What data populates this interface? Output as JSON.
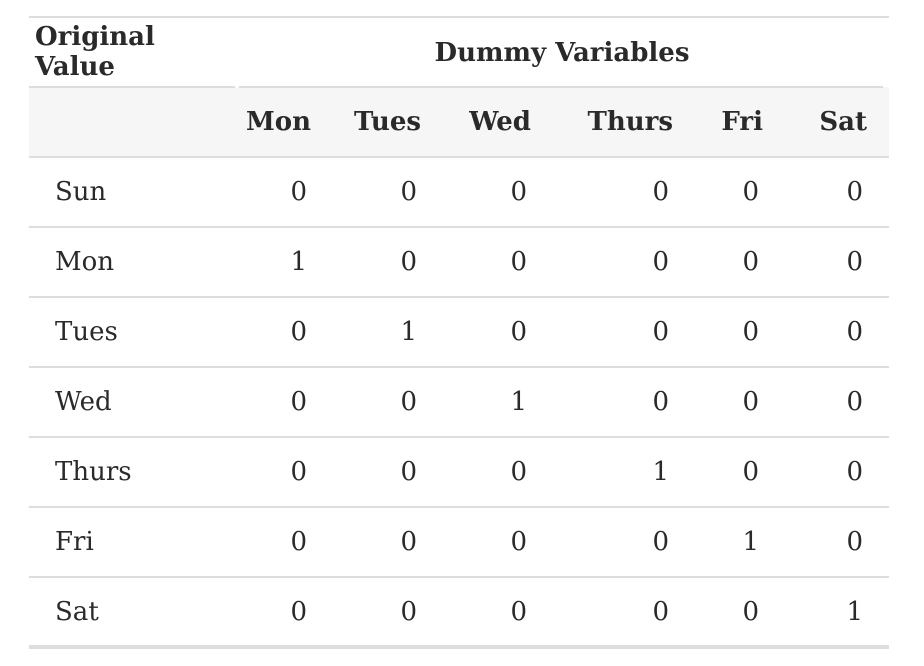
{
  "table": {
    "spanner": {
      "original_value": "Original Value",
      "dummy_variables": "Dummy Variables"
    },
    "columns": [
      "Mon",
      "Tues",
      "Wed",
      "Thurs",
      "Fri",
      "Sat"
    ],
    "rows": [
      {
        "label": "Sun",
        "values": [
          "0",
          "0",
          "0",
          "0",
          "0",
          "0"
        ]
      },
      {
        "label": "Mon",
        "values": [
          "1",
          "0",
          "0",
          "0",
          "0",
          "0"
        ]
      },
      {
        "label": "Tues",
        "values": [
          "0",
          "1",
          "0",
          "0",
          "0",
          "0"
        ]
      },
      {
        "label": "Wed",
        "values": [
          "0",
          "0",
          "1",
          "0",
          "0",
          "0"
        ]
      },
      {
        "label": "Thurs",
        "values": [
          "0",
          "0",
          "0",
          "1",
          "0",
          "0"
        ]
      },
      {
        "label": "Fri",
        "values": [
          "0",
          "0",
          "0",
          "0",
          "1",
          "0"
        ]
      },
      {
        "label": "Sat",
        "values": [
          "0",
          "0",
          "0",
          "0",
          "0",
          "1"
        ]
      }
    ]
  }
}
